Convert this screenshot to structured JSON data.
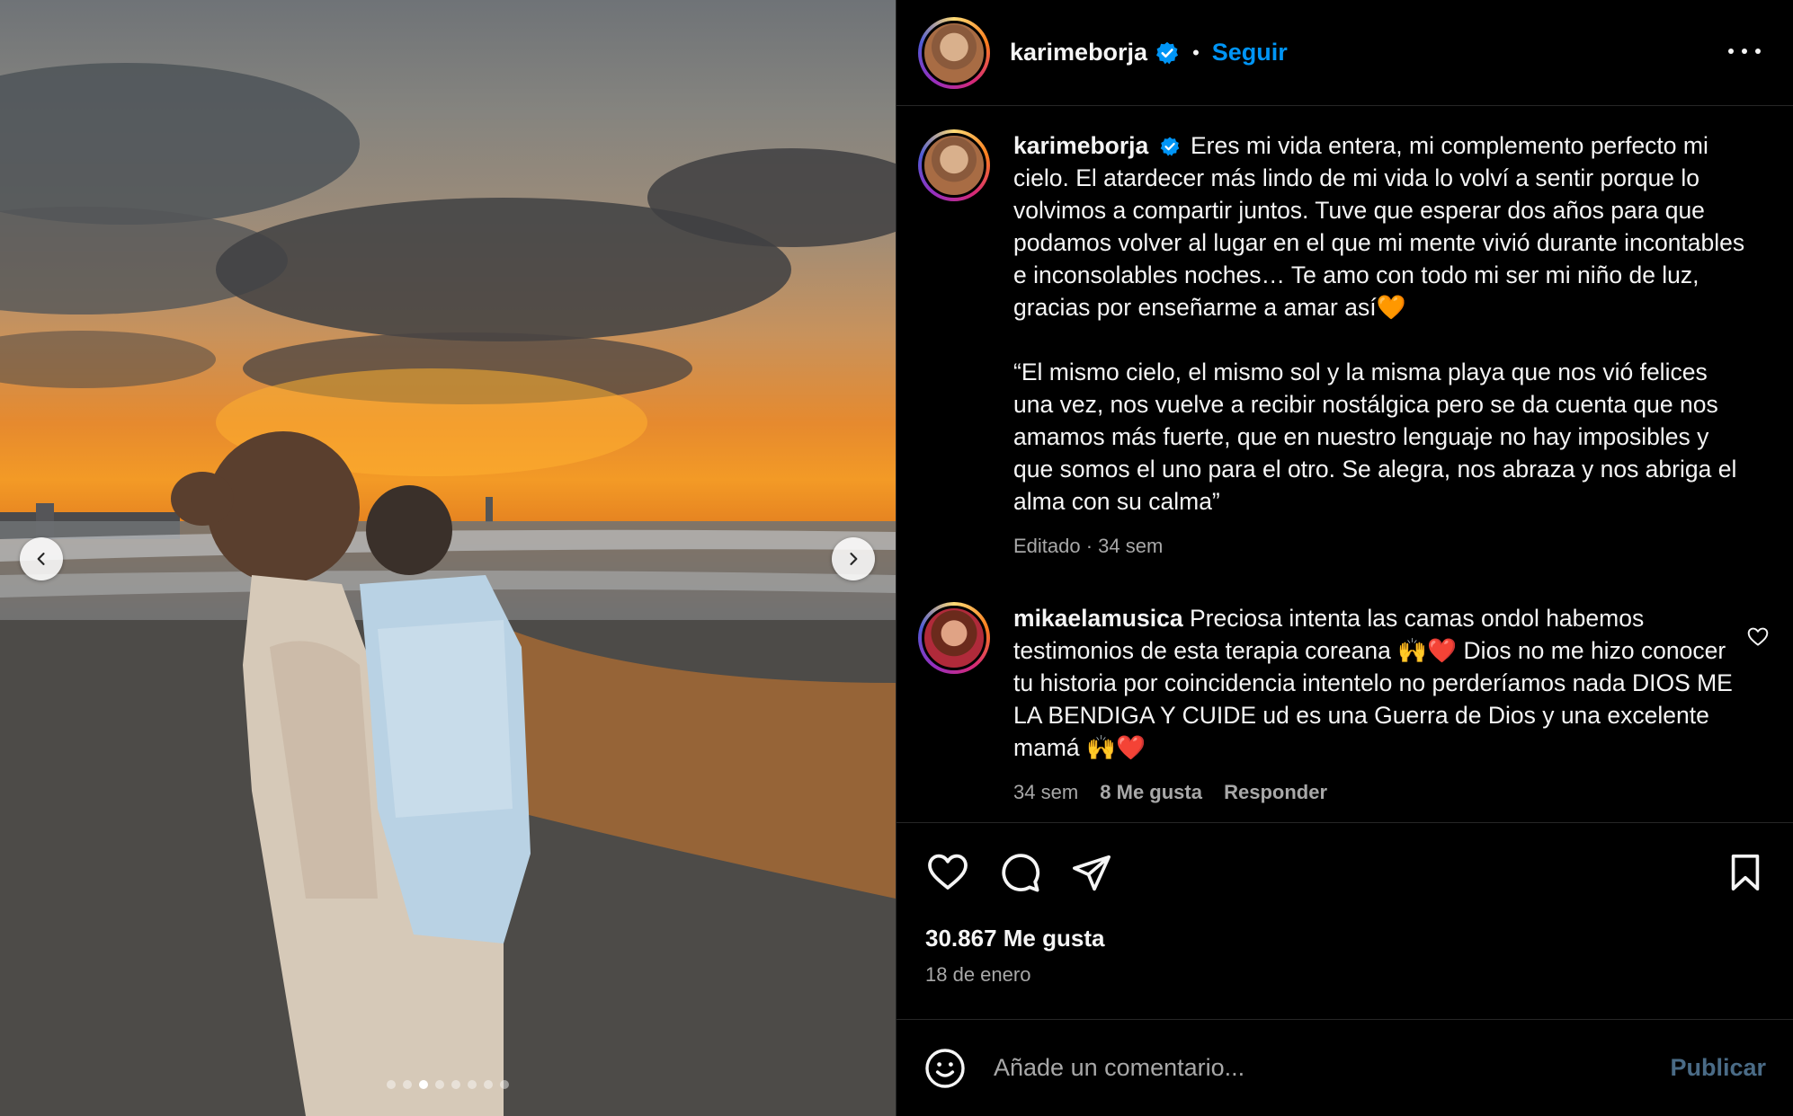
{
  "post": {
    "username": "karimeborja",
    "follow_label": "Seguir",
    "separator": "•",
    "caption_p1": "Eres mi vida entera, mi complemento perfecto mi cielo. El atardecer más lindo de mi vida lo volví a sentir porque lo volvimos a compartir juntos. Tuve que esperar dos años para que podamos volver al lugar en el que mi mente vivió durante incontables e inconsolables noches… Te amo con todo mi ser mi niño de luz, gracias por enseñarme a amar así🧡",
    "caption_p2": "“El mismo cielo, el mismo sol y la misma playa que nos vió felices una vez, nos vuelve a recibir nostálgica pero se da cuenta que nos amamos más fuerte, que en nuestro lenguaje no hay imposibles y que somos el uno para el otro. Se alegra, nos abraza y nos abriga el alma con su calma”",
    "caption_meta": "Editado · 34 sem",
    "likes": "30.867 Me gusta",
    "date": "18 de enero",
    "carousel": {
      "total": 8,
      "active_index": 2
    }
  },
  "comments": [
    {
      "username": "mikaelamusica",
      "text": "Preciosa intenta las camas ondol habemos testimonios de esta terapia coreana 🙌❤️ Dios no me hizo conocer tu historia por coincidencia intentelo no perderíamos nada DIOS ME LA BENDIGA Y CUIDE ud es una Guerra de Dios y una excelente mamá 🙌❤️",
      "time": "34 sem",
      "likes": "8 Me gusta",
      "reply": "Responder"
    }
  ],
  "composer": {
    "placeholder": "Añade un comentario...",
    "publish_label": "Publicar"
  },
  "icons": {
    "verified": "verified-badge-icon",
    "more": "more-options-icon",
    "like": "heart-icon",
    "comment": "comment-icon",
    "share": "share-icon",
    "save": "bookmark-icon",
    "emoji": "emoji-icon",
    "prev": "chevron-left-icon",
    "next": "chevron-right-icon"
  },
  "colors": {
    "accent": "#0095f6",
    "background": "#000000",
    "muted_text": "#a8a8a8",
    "publish_disabled": "#4a6b86"
  }
}
